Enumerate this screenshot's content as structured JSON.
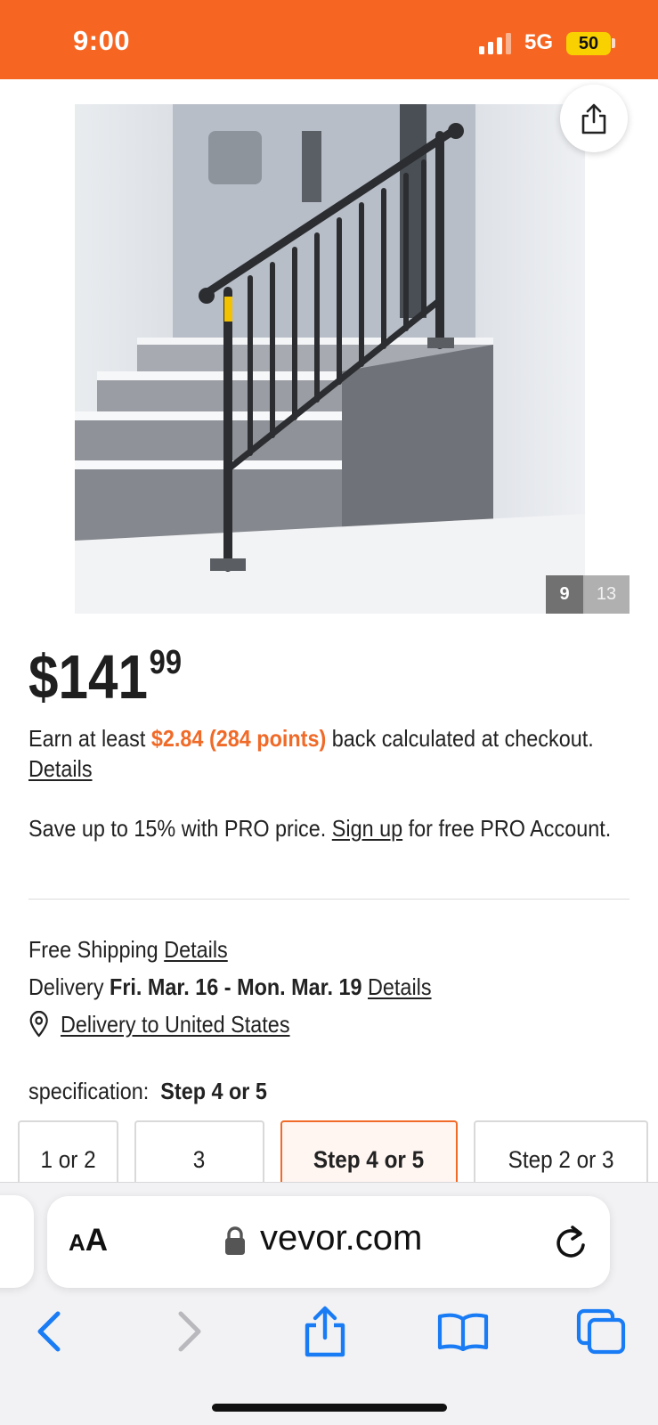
{
  "status_bar": {
    "time": "9:00",
    "network": "5G",
    "battery": "50"
  },
  "product": {
    "image_icon": "stair-handrail-photo",
    "image_counter": {
      "current": "9",
      "total": "13"
    },
    "price": {
      "symbol": "$",
      "dollars": "141",
      "cents": "99"
    },
    "rewards": {
      "prefix": "Earn at least ",
      "amount": "$2.84 (284 points)",
      "suffix": " back calculated at checkout. ",
      "link": "Details"
    },
    "pro": {
      "prefix": "Save up to 15% with PRO price. ",
      "link": "Sign up",
      "suffix": " for free PRO Account."
    },
    "shipping": {
      "label": "Free Shipping ",
      "link": "Details"
    },
    "delivery": {
      "label": "Delivery ",
      "dates": "Fri. Mar. 16 - Mon. Mar. 19",
      "link": "Details"
    },
    "delivery_location": "Delivery to United States",
    "specification": {
      "label": "specification:",
      "selected": "Step 4 or 5",
      "options": [
        "1 or 2",
        "3",
        "Step 4 or 5",
        "Step 2 or 3"
      ]
    }
  },
  "browser": {
    "aa_label_small": "A",
    "aa_label_big": "A",
    "domain": "vevor.com"
  },
  "colors": {
    "brand_orange": "#f66622",
    "accent_orange": "#f06a28",
    "ios_blue": "#1a7cf5"
  }
}
